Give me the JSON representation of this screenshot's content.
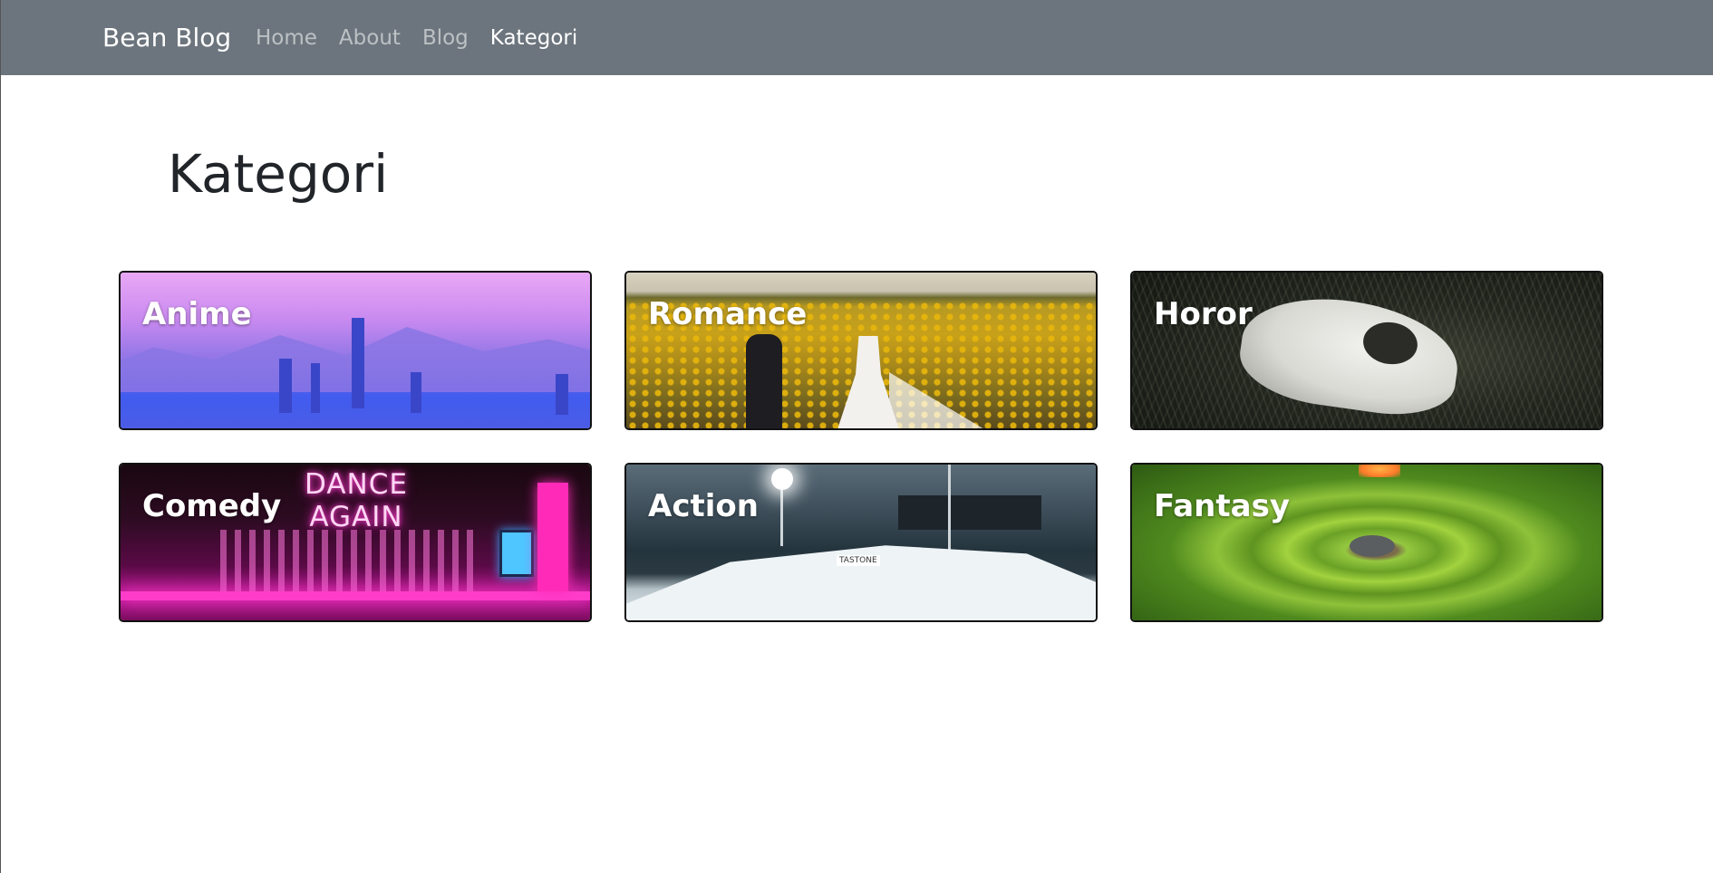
{
  "navbar": {
    "brand": "Bean Blog",
    "links": [
      {
        "label": "Home",
        "active": false
      },
      {
        "label": "About",
        "active": false
      },
      {
        "label": "Blog",
        "active": false
      },
      {
        "label": "Kategori",
        "active": true
      }
    ]
  },
  "page": {
    "title": "Kategori"
  },
  "categories": [
    {
      "label": "Anime",
      "image": "city-skyline-purple-dusk"
    },
    {
      "label": "Romance",
      "image": "couple-sunflower-field"
    },
    {
      "label": "Horor",
      "image": "animal-skull-on-grass"
    },
    {
      "label": "Comedy",
      "image": "neon-bar-dance-again"
    },
    {
      "label": "Action",
      "image": "ski-jump-stadium-night"
    },
    {
      "label": "Fantasy",
      "image": "green-spiral-field"
    }
  ],
  "comedy_neon_sign": [
    "DANCE",
    "AGAIN"
  ],
  "action_banner": [
    "TASTONE"
  ],
  "colors": {
    "navbar_bg": "#6c757d",
    "page_bg": "#ffffff",
    "title_text": "#212529",
    "nav_active": "#ffffff",
    "nav_inactive": "rgba(255,255,255,0.55)"
  }
}
